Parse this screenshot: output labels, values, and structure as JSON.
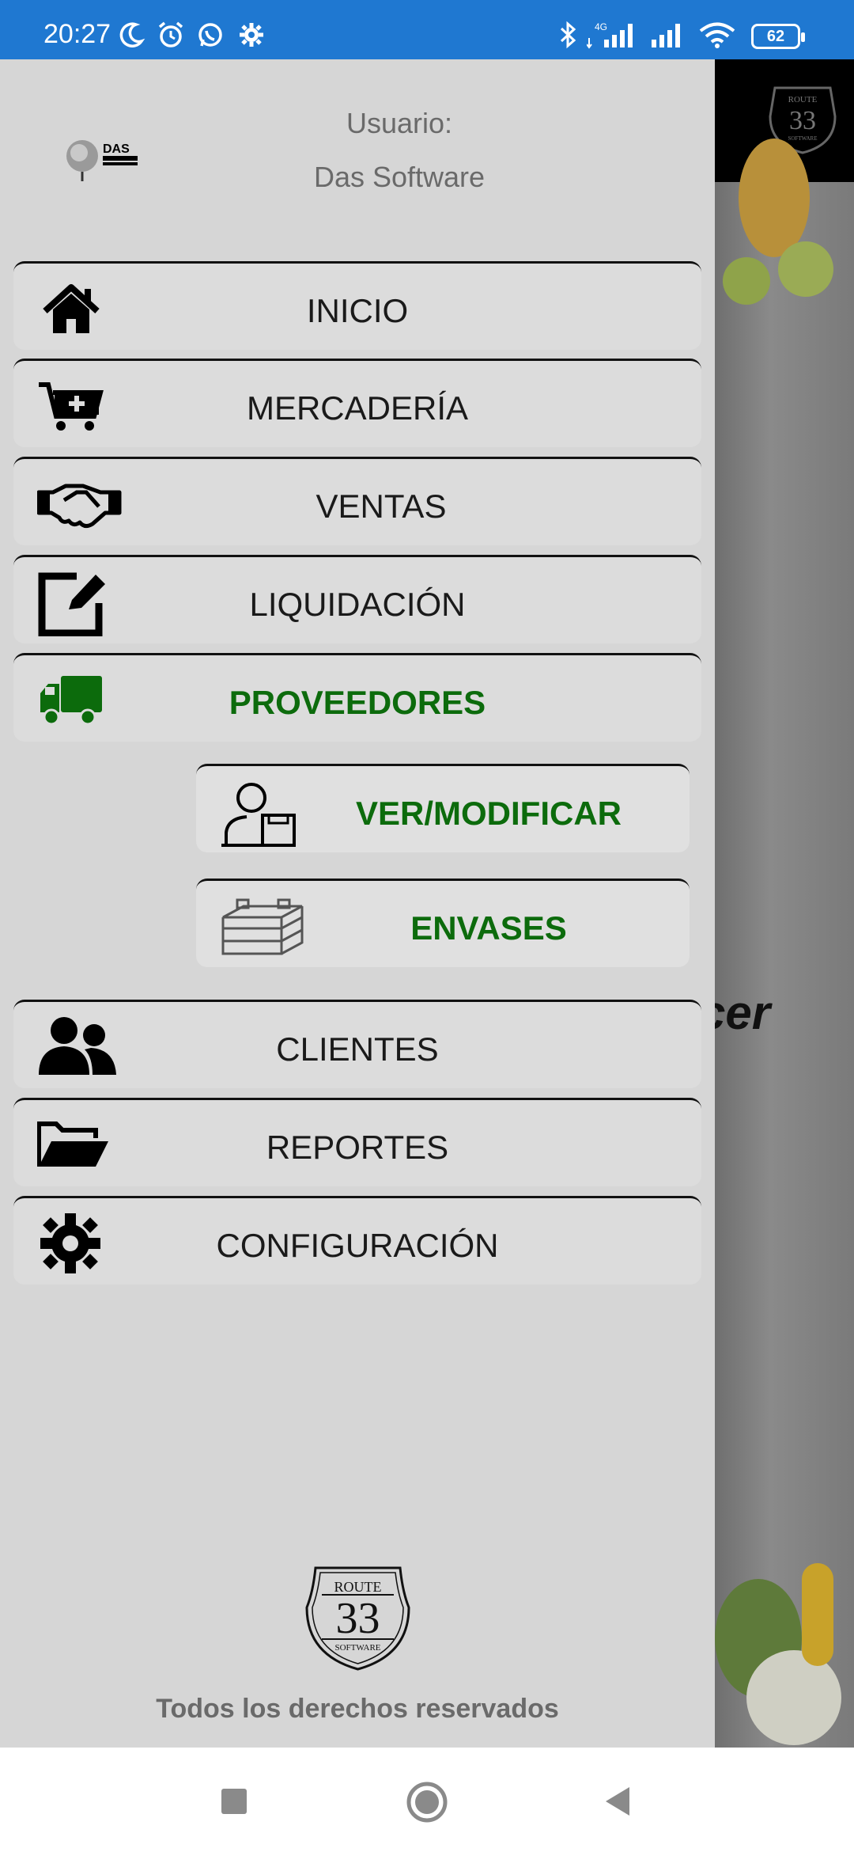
{
  "status_bar": {
    "time": "20:27",
    "battery": "62",
    "network": "4G",
    "icons": [
      "moon-icon",
      "alarm-icon",
      "whatsapp-icon",
      "gear-icon",
      "bluetooth-icon",
      "signal-icon",
      "wifi-icon"
    ]
  },
  "drawer": {
    "user_label": "Usuario:",
    "user_name": "Das Software",
    "logo_text": "DAS",
    "menu": [
      {
        "label": "INICIO",
        "icon": "home-icon"
      },
      {
        "label": "MERCADERÍA",
        "icon": "cart-add-icon"
      },
      {
        "label": "VENTAS",
        "icon": "handshake-icon"
      },
      {
        "label": "LIQUIDACIÓN",
        "icon": "edit-icon"
      },
      {
        "label": "PROVEEDORES",
        "icon": "truck-icon",
        "active": true
      },
      {
        "label": "CLIENTES",
        "icon": "users-icon"
      },
      {
        "label": "REPORTES",
        "icon": "folder-open-icon"
      },
      {
        "label": "CONFIGURACIÓN",
        "icon": "gear-icon"
      }
    ],
    "submenu": [
      {
        "label": "VER/MODIFICAR",
        "icon": "person-box-icon"
      },
      {
        "label": "ENVASES",
        "icon": "crate-icon"
      }
    ],
    "footer_logo": {
      "top": "ROUTE",
      "number": "33",
      "bottom": "SOFTWARE"
    },
    "footer_text": "Todos los derechos reservados"
  },
  "background": {
    "partial_text": "cer"
  },
  "colors": {
    "status_bar": "#1f78d1",
    "drawer_bg": "#d6d6d6",
    "active_green": "#0c6b0c",
    "text_gray": "#6a6a6a"
  },
  "navigation": [
    "recent-apps-icon",
    "home-circle-icon",
    "back-icon"
  ]
}
